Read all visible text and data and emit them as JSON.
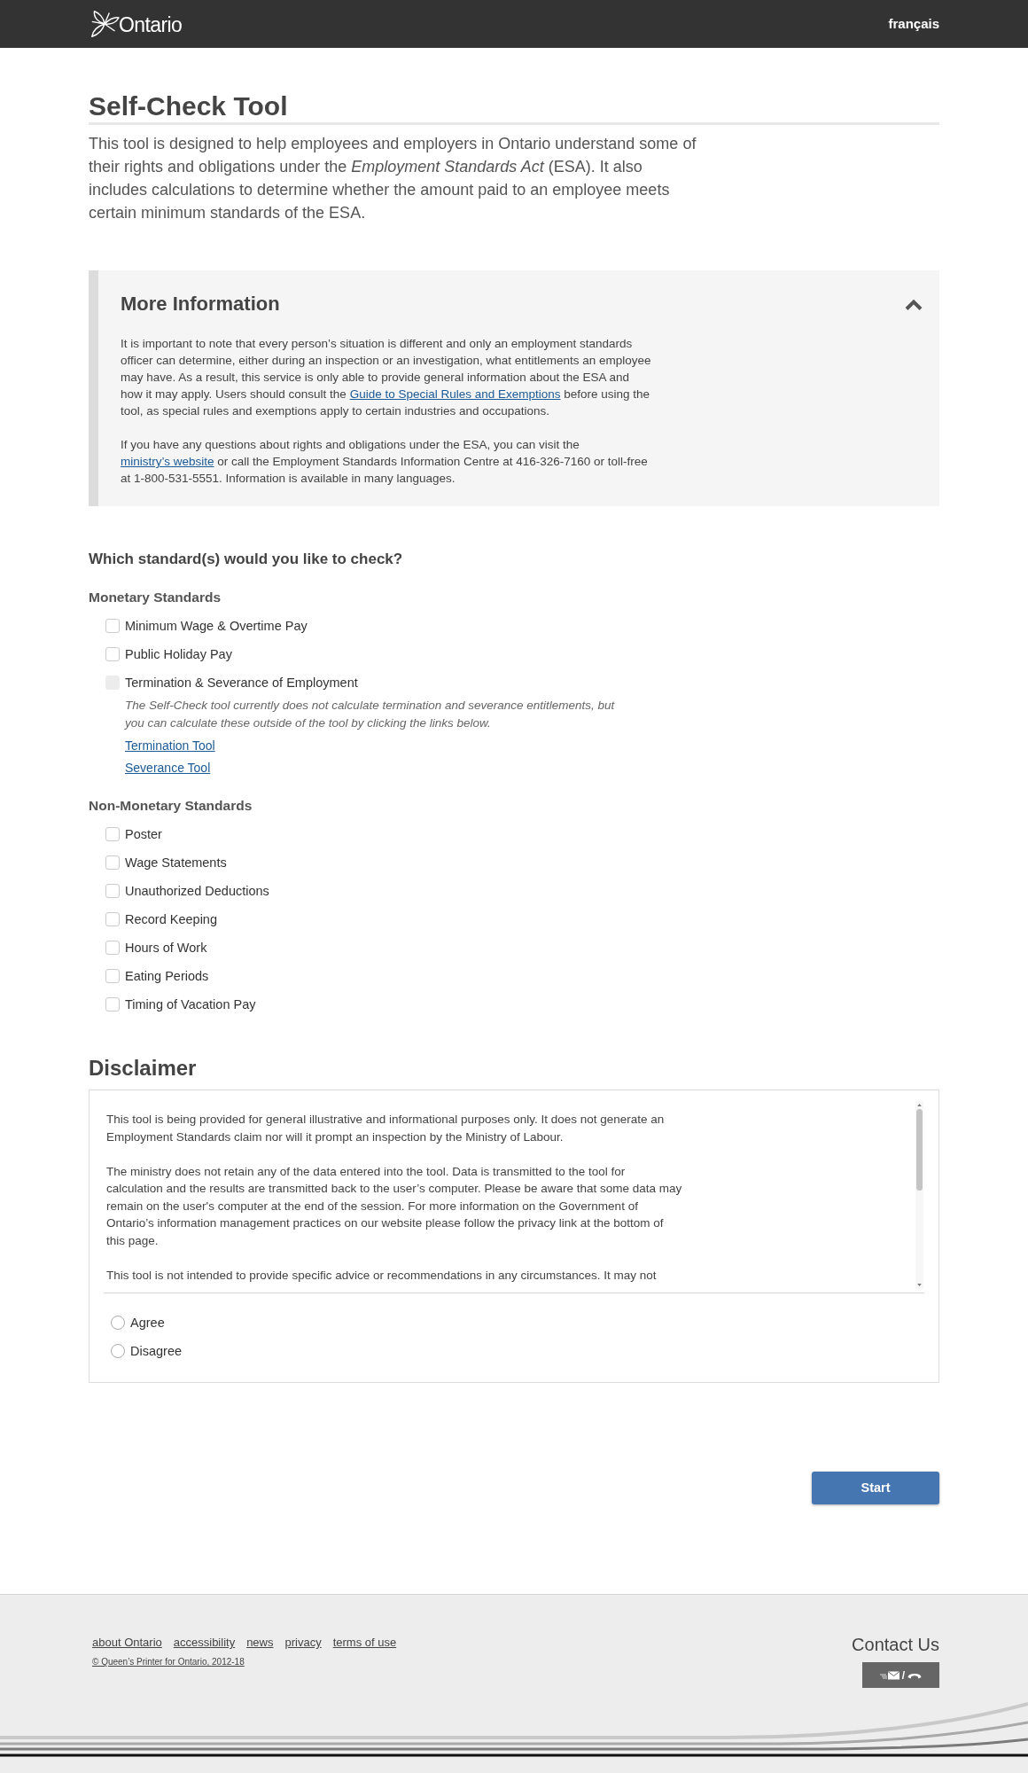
{
  "header": {
    "logo_text": "Ontario",
    "language_link": "français"
  },
  "page_title": "Self-Check Tool",
  "intro": "This tool is designed to help employees and employers in Ontario understand some of their rights and obligations under the *Employment Standards Act* (ESA). It also includes calculations to determine whether the amount paid to an employee meets certain minimum standards of the ESA.",
  "more_info": {
    "title": "More Information",
    "expanded": true,
    "paragraphs": [
      [
        {
          "kind": "text",
          "text": "It is important to note that every person’s situation is different and only an employment standards officer can determine, either during an inspection or an investigation, what entitlements an employee may have. As a result, this service is only able to provide general information about the ESA and how it may apply. Users should consult the "
        },
        {
          "kind": "link",
          "text": "Guide to Special Rules and Exemptions"
        },
        {
          "kind": "text",
          "text": " before using the tool, as special rules and exemptions apply to certain industries and occupations."
        }
      ],
      [
        {
          "kind": "text",
          "text": "If you have any questions about rights and obligations under the ESA, you can visit the "
        },
        {
          "kind": "link",
          "text": "ministry’s website"
        },
        {
          "kind": "text",
          "text": " or call the Employment Standards Information Centre at 416-326-7160 or toll-free at 1-800-531-5551. Information is available in many languages."
        }
      ]
    ]
  },
  "question": "Which standard(s) would you like to check?",
  "groups": [
    {
      "title": "Monetary Standards",
      "items": [
        {
          "label": "Minimum Wage & Overtime Pay",
          "checked": false,
          "disabled": false
        },
        {
          "label": "Public Holiday Pay",
          "checked": false,
          "disabled": false
        },
        {
          "label": "Termination & Severance of Employment",
          "checked": false,
          "disabled": true,
          "note": "The Self-Check tool currently does not calculate termination and severance entitlements, but you can calculate these outside of the tool by clicking the links below.",
          "links": [
            "Termination Tool",
            "Severance Tool"
          ]
        }
      ]
    },
    {
      "title": "Non-Monetary Standards",
      "items": [
        {
          "label": "Poster",
          "checked": false,
          "disabled": false
        },
        {
          "label": "Wage Statements",
          "checked": false,
          "disabled": false
        },
        {
          "label": "Unauthorized Deductions",
          "checked": false,
          "disabled": false
        },
        {
          "label": "Record Keeping",
          "checked": false,
          "disabled": false
        },
        {
          "label": "Hours of Work",
          "checked": false,
          "disabled": false
        },
        {
          "label": "Eating Periods",
          "checked": false,
          "disabled": false
        },
        {
          "label": "Timing of Vacation Pay",
          "checked": false,
          "disabled": false
        }
      ]
    }
  ],
  "disclaimer": {
    "title": "Disclaimer",
    "paragraphs": [
      "This tool is being provided for general illustrative and informational purposes only. It does not generate an Employment Standards claim nor will it prompt an inspection by the Ministry of Labour.",
      "The ministry does not retain any of the data entered into the tool. Data is transmitted to the tool for calculation and the results are transmitted back to the user’s computer. Please be aware that some data may remain on the user's computer at the end of the session. For more information on the Government of Ontario’s information management practices on our website please follow the privacy link at the bottom of this page.",
      "This tool is not intended to provide specific advice or recommendations in any circumstances. It may not"
    ],
    "options": [
      {
        "label": "Agree",
        "selected": false
      },
      {
        "label": "Disagree",
        "selected": false
      }
    ]
  },
  "start_button": "Start",
  "footer": {
    "links": [
      "about Ontario",
      "accessibility",
      "news",
      "privacy",
      "terms of use"
    ],
    "copyright": "© Queen’s Printer for Ontario, 2012-18",
    "contact_title": "Contact Us",
    "contact_separator": "/"
  }
}
